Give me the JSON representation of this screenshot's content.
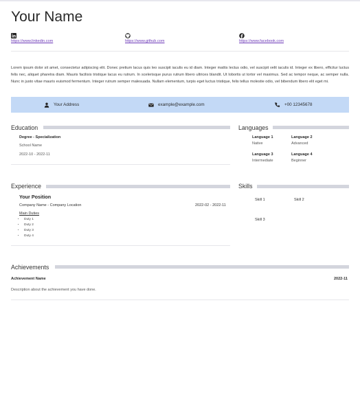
{
  "header": {
    "name": "Your Name"
  },
  "links": [
    {
      "icon": "linkedin-icon",
      "url": "https://www.linkedin.com"
    },
    {
      "icon": "github-icon",
      "url": "https://www.github.com"
    },
    {
      "icon": "facebook-icon",
      "url": "https://www.facebook.com"
    }
  ],
  "summary": "Lorem ipsum dolor sit amet, consectetur adipiscing elit. Donec pretium lacus quis leo suscipit iaculis eu id diam. Integer mattis lectus odio, vel suscipit velit iaculis id. Integer ex libero, efficitur luctus felis nec, aliquet pharetra diam. Mauris facilisis tristique lacus eu rutrum. In scelerisque purus rutrum libero ultrices blandit. Ut lobortis ut tortor vel maximus. Sed ac tempor neque, ac semper nulla. Nunc in justo vitae mauris euismod fermentum. Integer rutrum semper malesuada. Nullam elementum, turpis eget luctus tristique, felis tellus molestie odio, vel bibendum libero elit eget mi.",
  "contact": {
    "address": "Your Address",
    "email": "example@example.com",
    "phone": "+00 12345678",
    "accent": "#c3d9f6"
  },
  "education": {
    "title": "Education",
    "degree": "Degree - Specialization",
    "school": "School Name",
    "dates": "2022-10 - 2022-11"
  },
  "languages": {
    "title": "Languages",
    "items": [
      {
        "name": "Language 1",
        "level": "Native"
      },
      {
        "name": "Language 2",
        "level": "Advanced"
      },
      {
        "name": "Language 3",
        "level": "Intermediate"
      },
      {
        "name": "Language 4",
        "level": "Beginner"
      }
    ]
  },
  "experience": {
    "title": "Experience",
    "position": "Your Position",
    "company": "Company Name - Company Location",
    "dates": "2022-02 - 2022-11",
    "duties_title": "Main Duties",
    "duties": [
      "Duty 1",
      "Duty 2",
      "Duty 3",
      "Duty 4"
    ]
  },
  "skills": {
    "title": "Skills",
    "items": [
      "Skill 1",
      "Skill 2",
      "Skill 3"
    ]
  },
  "achievements": {
    "title": "Achievements",
    "name": "Achievement Name",
    "date": "2022-11",
    "description": "Description about the achievement you have done."
  }
}
